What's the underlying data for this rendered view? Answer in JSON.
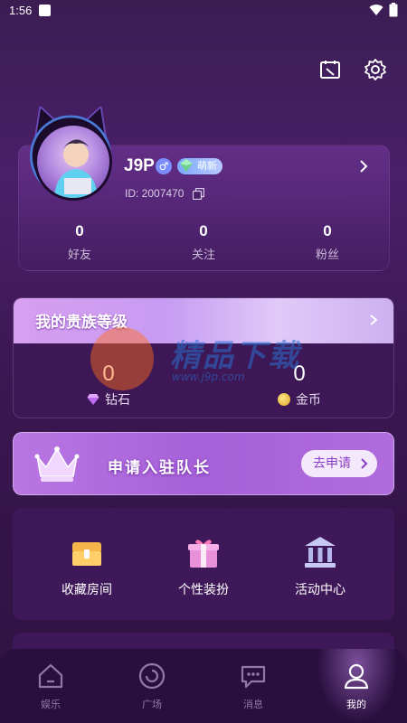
{
  "status_bar": {
    "time": "1:56"
  },
  "profile": {
    "username": "J9P",
    "gender_symbol": "♂",
    "level_label": "萌新",
    "id_text": "ID: 2007470",
    "stats": [
      {
        "value": "0",
        "label": "好友"
      },
      {
        "value": "0",
        "label": "关注"
      },
      {
        "value": "0",
        "label": "粉丝"
      }
    ]
  },
  "noble": {
    "title": "我的贵族等级",
    "diamonds_value": "0",
    "diamonds_label": "钻石",
    "coins_value": "0",
    "coins_label": "金币"
  },
  "watermark": {
    "text": "精品下载",
    "url": "www.j9p.com"
  },
  "captain": {
    "title": "申请入驻队长",
    "button_label": "去申请"
  },
  "features": [
    {
      "icon": "treasure-chest-icon",
      "label": "收藏房间"
    },
    {
      "icon": "gift-box-icon",
      "label": "个性装扮"
    },
    {
      "icon": "bank-building-icon",
      "label": "活动中心"
    }
  ],
  "tabs": [
    {
      "icon": "home-icon",
      "label": "娱乐",
      "active": false
    },
    {
      "icon": "plaza-circle-icon",
      "label": "广场",
      "active": false
    },
    {
      "icon": "message-bubble-icon",
      "label": "消息",
      "active": false
    },
    {
      "icon": "person-icon",
      "label": "我的",
      "active": true
    }
  ],
  "colors": {
    "background": "#3b1d52",
    "accent": "#a660d8",
    "apply_button_text": "#8a3ec8",
    "tab_inactive": "#8f7aa3"
  }
}
